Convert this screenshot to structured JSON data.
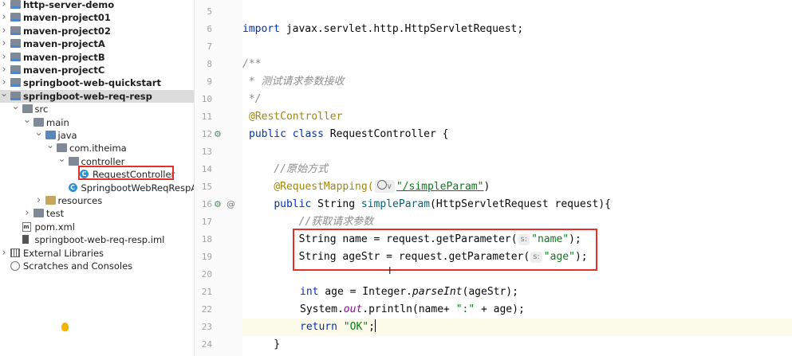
{
  "project_tree": {
    "items": [
      {
        "label": "http-server-demo",
        "icon": "module-folder-icon",
        "depth": 0,
        "bold": true,
        "arrow": "right"
      },
      {
        "label": "maven-project01",
        "icon": "module-folder-icon",
        "depth": 0,
        "bold": true,
        "arrow": "right"
      },
      {
        "label": "maven-project02",
        "icon": "module-folder-icon",
        "depth": 0,
        "bold": true,
        "arrow": "right"
      },
      {
        "label": "maven-projectA",
        "icon": "module-folder-icon",
        "depth": 0,
        "bold": true,
        "arrow": "right"
      },
      {
        "label": "maven-projectB",
        "icon": "module-folder-icon",
        "depth": 0,
        "bold": true,
        "arrow": "right"
      },
      {
        "label": "maven-projectC",
        "icon": "module-folder-icon",
        "depth": 0,
        "bold": true,
        "arrow": "right"
      },
      {
        "label": "springboot-web-quickstart",
        "icon": "module-folder-icon",
        "depth": 0,
        "bold": true,
        "arrow": "right"
      },
      {
        "label": "springboot-web-req-resp",
        "icon": "module-folder-icon",
        "depth": 0,
        "bold": true,
        "arrow": "down",
        "selected": true
      },
      {
        "label": "src",
        "icon": "folder-icon",
        "depth": 1,
        "arrow": "down"
      },
      {
        "label": "main",
        "icon": "folder-icon",
        "depth": 2,
        "arrow": "down"
      },
      {
        "label": "java",
        "icon": "source-folder-icon",
        "depth": 3,
        "arrow": "down"
      },
      {
        "label": "com.itheima",
        "icon": "package-icon",
        "depth": 4,
        "arrow": "down"
      },
      {
        "label": "controller",
        "icon": "package-icon",
        "depth": 5,
        "arrow": "down"
      },
      {
        "label": "RequestController",
        "icon": "class-icon",
        "depth": 6,
        "arrow": ""
      },
      {
        "label": "SpringbootWebReqRespAp",
        "icon": "class-icon",
        "depth": 5,
        "arrow": ""
      },
      {
        "label": "resources",
        "icon": "resources-folder-icon",
        "depth": 3,
        "arrow": "right"
      },
      {
        "label": "test",
        "icon": "folder-icon",
        "depth": 2,
        "arrow": "right"
      },
      {
        "label": "pom.xml",
        "icon": "maven-file-icon",
        "depth": 1,
        "arrow": ""
      },
      {
        "label": "springboot-web-req-resp.iml",
        "icon": "iml-file-icon",
        "depth": 1,
        "arrow": ""
      },
      {
        "label": "External Libraries",
        "icon": "library-icon",
        "depth": 0,
        "arrow": "right"
      },
      {
        "label": "Scratches and Consoles",
        "icon": "scratches-icon",
        "depth": 0,
        "arrow": ""
      }
    ]
  },
  "gutter": {
    "line_numbers": [
      "5",
      "6",
      "7",
      "8",
      "9",
      "10",
      "11",
      "12",
      "13",
      "14",
      "15",
      "16",
      "17",
      "18",
      "19",
      "20",
      "21",
      "22",
      "23",
      "24"
    ]
  },
  "code": {
    "line6_import": "import",
    "line6_rest": " javax.servlet.http.HttpServletRequest;",
    "line8": "/**",
    "line9": " * 测试请求参数接收",
    "line10": " */",
    "line11": "@RestController",
    "line12_kw1": "public",
    "line12_kw2": "class",
    "line12_rest": " RequestController {",
    "line14": "    //原始方式",
    "line15_ann": "    @RequestMapping(",
    "line15_hint": "∨",
    "line15_str": "\"/simpleParam\"",
    "line15_end": ")",
    "line16_kw": "public",
    "line16_type": " String ",
    "line16_method": "simpleParam",
    "line16_rest": "(HttpServletRequest request){",
    "line17": "        //获取请求参数",
    "line18_pre": "        String name = request.getParameter(",
    "line18_hint": "s:",
    "line18_str": "\"name\"",
    "line18_end": ");",
    "line19_pre": "        String ageStr = request.getParameter(",
    "line19_hint": "s:",
    "line19_str": "\"age\"",
    "line19_end": ");",
    "line21_kw": "int",
    "line21_a": " age = Integer.",
    "line21_m": "parseInt",
    "line21_b": "(ageStr);",
    "line22_a": "System.",
    "line22_f": "out",
    "line22_b": ".println(name+ ",
    "line22_s": "\":\"",
    "line22_c": " + age);",
    "line23_kw": "return",
    "line23_s": " \"OK\"",
    "line23_end": ";",
    "line24": "    }"
  }
}
